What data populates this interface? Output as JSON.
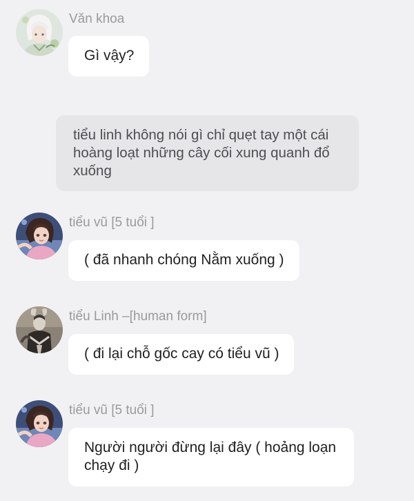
{
  "messages": [
    {
      "type": "character",
      "sender": "Văn khoa",
      "avatar": "white-haired-character-avatar",
      "text": "Gì vậy?"
    },
    {
      "type": "narration",
      "text": "tiểu linh không nói gì chỉ quẹt tay một cái hoàng loạt những cây cối xung quanh đổ xuống"
    },
    {
      "type": "character",
      "sender": "tiểu vũ [5 tuổi ]",
      "avatar": "girl-character-avatar",
      "text": "( đã nhanh chóng Nằm xuống )"
    },
    {
      "type": "character",
      "sender": "tiểu Linh –[human form]",
      "avatar": "armored-character-avatar",
      "text": "( đi lại chỗ gốc cay có tiểu vũ )"
    },
    {
      "type": "character",
      "sender": "tiểu vũ [5 tuổi ]",
      "avatar": "girl-character-avatar",
      "text": "Người người đừng lại đây ( hoảng loạn chạy đi )"
    }
  ],
  "colors": {
    "background": "#f1f1f3",
    "bubble": "#ffffff",
    "narration_bubble": "#e6e6e9",
    "sender_text": "#9a9a9e"
  }
}
